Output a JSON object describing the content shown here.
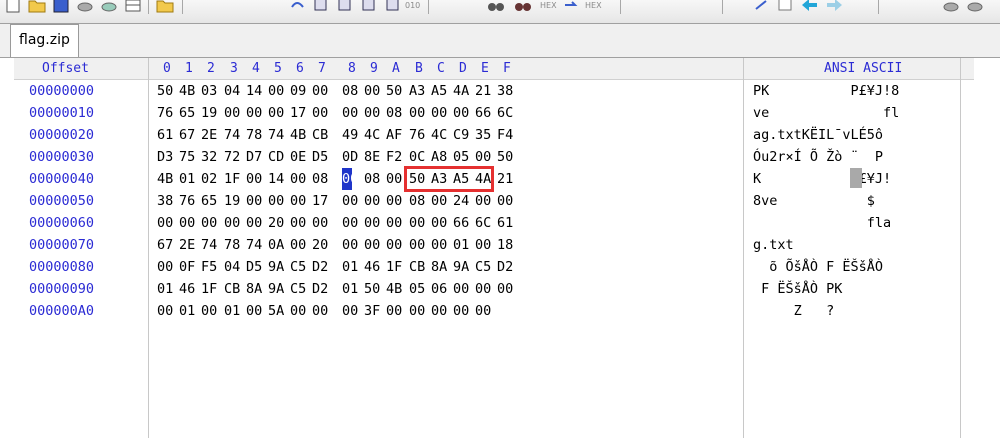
{
  "tab": {
    "label": "flag.zip"
  },
  "toolbar": {
    "hex_label_1": "HEX",
    "hex_label_2": "HEX",
    "label_010": "010"
  },
  "header": {
    "offset": "Offset",
    "cols": [
      "0",
      "1",
      "2",
      "3",
      "4",
      "5",
      "6",
      "7",
      "8",
      "9",
      "A",
      "B",
      "C",
      "D",
      "E",
      "F"
    ],
    "ascii": "ANSI ASCII"
  },
  "rows": [
    {
      "offset": "00000000",
      "bytes": [
        "50",
        "4B",
        "03",
        "04",
        "14",
        "00",
        "09",
        "00",
        "08",
        "00",
        "50",
        "A3",
        "A5",
        "4A",
        "21",
        "38"
      ],
      "ascii": "PK          P£¥J!8"
    },
    {
      "offset": "00000010",
      "bytes": [
        "76",
        "65",
        "19",
        "00",
        "00",
        "00",
        "17",
        "00",
        "00",
        "00",
        "08",
        "00",
        "00",
        "00",
        "66",
        "6C"
      ],
      "ascii": "ve              fl"
    },
    {
      "offset": "00000020",
      "bytes": [
        "61",
        "67",
        "2E",
        "74",
        "78",
        "74",
        "4B",
        "CB",
        "49",
        "4C",
        "AF",
        "76",
        "4C",
        "C9",
        "35",
        "F4"
      ],
      "ascii": "ag.txtKËIL¯vLÉ5ô"
    },
    {
      "offset": "00000030",
      "bytes": [
        "D3",
        "75",
        "32",
        "72",
        "D7",
        "CD",
        "0E",
        "D5",
        "0D",
        "8E",
        "F2",
        "0C",
        "A8",
        "05",
        "00",
        "50"
      ],
      "ascii": "Óu2r×Í Õ Žò ¨  P"
    },
    {
      "offset": "00000040",
      "bytes": [
        "4B",
        "01",
        "02",
        "1F",
        "00",
        "14",
        "00",
        "08",
        "00",
        "08",
        "00",
        "50",
        "A3",
        "A5",
        "4A",
        "21"
      ],
      "ascii": "K           P£¥J!"
    },
    {
      "offset": "00000050",
      "bytes": [
        "38",
        "76",
        "65",
        "19",
        "00",
        "00",
        "00",
        "17",
        "00",
        "00",
        "00",
        "08",
        "00",
        "24",
        "00",
        "00"
      ],
      "ascii": "8ve           $"
    },
    {
      "offset": "00000060",
      "bytes": [
        "00",
        "00",
        "00",
        "00",
        "00",
        "20",
        "00",
        "00",
        "00",
        "00",
        "00",
        "00",
        "00",
        "66",
        "6C",
        "61"
      ],
      "ascii": "              fla"
    },
    {
      "offset": "00000070",
      "bytes": [
        "67",
        "2E",
        "74",
        "78",
        "74",
        "0A",
        "00",
        "20",
        "00",
        "00",
        "00",
        "00",
        "00",
        "01",
        "00",
        "18"
      ],
      "ascii": "g.txt"
    },
    {
      "offset": "00000080",
      "bytes": [
        "00",
        "0F",
        "F5",
        "04",
        "D5",
        "9A",
        "C5",
        "D2",
        "01",
        "46",
        "1F",
        "CB",
        "8A",
        "9A",
        "C5",
        "D2"
      ],
      "ascii": "  õ ÕšÅÒ F ËŠšÅÒ"
    },
    {
      "offset": "00000090",
      "bytes": [
        "01",
        "46",
        "1F",
        "CB",
        "8A",
        "9A",
        "C5",
        "D2",
        "01",
        "50",
        "4B",
        "05",
        "06",
        "00",
        "00",
        "00"
      ],
      "ascii": " F ËŠšÅÒ PK"
    },
    {
      "offset": "000000A0",
      "bytes": [
        "00",
        "01",
        "00",
        "01",
        "00",
        "5A",
        "00",
        "00",
        "00",
        "3F",
        "00",
        "00",
        "00",
        "00",
        "00",
        ""
      ],
      "ascii": "     Z   ?"
    }
  ],
  "colors": {
    "offset_blue": "#2b2bd4",
    "selection": "#1f35c9",
    "highlight_box": "#e53030"
  }
}
